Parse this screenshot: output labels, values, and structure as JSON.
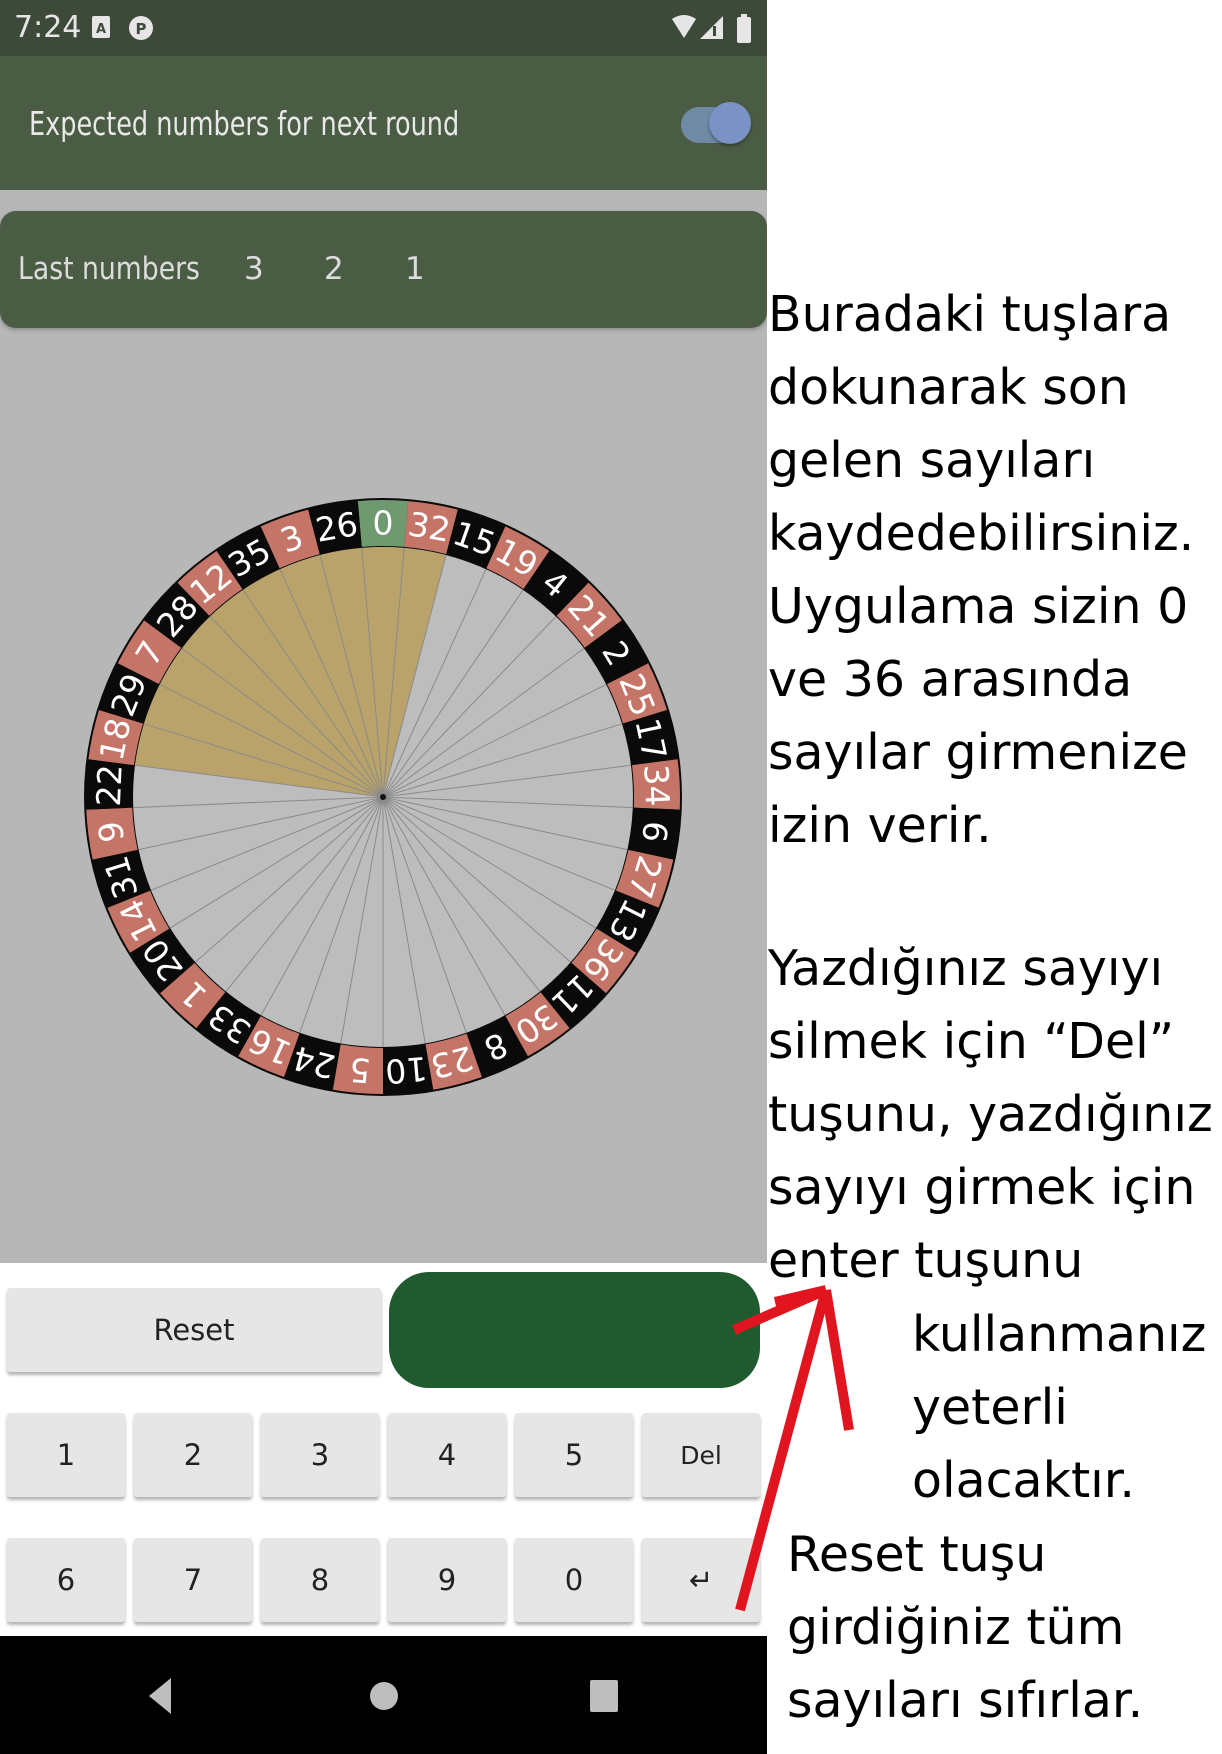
{
  "status_bar": {
    "time": "7:24",
    "icons": [
      "sim-card-a-icon",
      "circle-app-icon",
      "wifi-icon",
      "signal-icon",
      "battery-icon"
    ]
  },
  "app_bar": {
    "title": "Expected numbers for next round",
    "toggle_on": true
  },
  "last_numbers": {
    "label": "Last numbers",
    "values": [
      "3",
      "2",
      "1"
    ]
  },
  "wheel": {
    "sequence": [
      0,
      32,
      15,
      19,
      4,
      21,
      2,
      25,
      17,
      34,
      6,
      27,
      13,
      36,
      11,
      30,
      8,
      23,
      10,
      5,
      24,
      16,
      33,
      1,
      20,
      14,
      31,
      9,
      22,
      18,
      29,
      7,
      28,
      12,
      35,
      3,
      26
    ],
    "red_numbers": [
      1,
      3,
      5,
      7,
      9,
      12,
      14,
      16,
      18,
      19,
      21,
      23,
      25,
      27,
      30,
      32,
      34,
      36
    ],
    "highlighted_numbers": [
      3,
      26,
      0,
      32,
      35,
      12,
      28,
      7,
      29,
      18
    ],
    "colors": {
      "red": "#c47567",
      "black": "#0a0a0a",
      "green": "#6f9a6f",
      "highlight": "#b9a36a",
      "face": "#bdbdbd",
      "spoke": "#8a8a8a"
    }
  },
  "keypad": {
    "reset_label": "Reset",
    "keys_row1": [
      "1",
      "2",
      "3",
      "4",
      "5",
      "Del"
    ],
    "keys_row2": [
      "6",
      "7",
      "8",
      "9",
      "0",
      "↵"
    ],
    "enter_color": "#1f5b2f"
  },
  "nav_bar": {
    "icons": [
      "back-icon",
      "home-icon",
      "recents-icon"
    ]
  },
  "annotations": {
    "block1": "Buradaki tuşlara\ndokunarak son\ngelen sayıları\nkaydedebilirsiniz.\nUygulama sizin 0\nve 36 arasında\nsayılar girmenize\nizin verir.",
    "block2": "Yazdığınız sayıyı\nsilmek için “Del”\ntuşunu, yazdığınız\nsayıyı girmek için\nenter tuşunu",
    "block3": "kullanmanız\nyeterli\nolacaktır.",
    "block4": "Reset tuşu\ngirdiğiniz tüm\nsayıları sıfırlar.",
    "arrow_color": "#e0151f"
  }
}
